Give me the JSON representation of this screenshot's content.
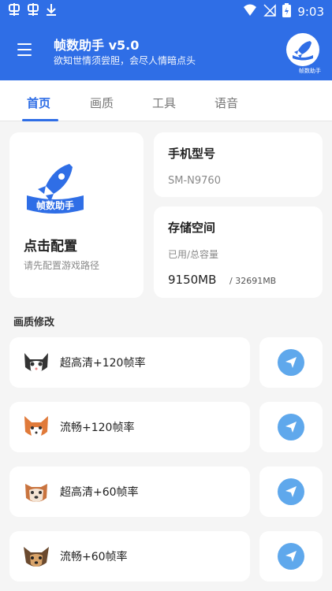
{
  "status_bar": {
    "left_icons": [
      "app-notification-icon",
      "app-notification-icon",
      "download-icon"
    ],
    "right_icons": [
      "wifi-icon",
      "no-signal-icon",
      "battery-icon"
    ],
    "time": "9:03"
  },
  "app_bar": {
    "title": "帧数助手 v5.0",
    "subtitle": "欲知世情须尝胆，会尽人情暗点头",
    "logo_label": "帧数助手"
  },
  "tabs": [
    {
      "label": "首页",
      "active": true
    },
    {
      "label": "画质",
      "active": false
    },
    {
      "label": "工具",
      "active": false
    },
    {
      "label": "语音",
      "active": false
    }
  ],
  "config_card": {
    "logo_text": "帧数助手",
    "title": "点击配置",
    "subtitle": "请先配置游戏路径"
  },
  "model_card": {
    "title": "手机型号",
    "value": "SM-N9760"
  },
  "storage_card": {
    "title": "存储空间",
    "label": "已用/总容量",
    "used": "9150MB",
    "total": "/ 32691MB"
  },
  "section_title": "画质修改",
  "presets": [
    {
      "label": "超高清+120帧率",
      "icon": "cat-icon"
    },
    {
      "label": "流畅+120帧率",
      "icon": "fox-icon"
    },
    {
      "label": "超高清+60帧率",
      "icon": "dog-icon"
    },
    {
      "label": "流畅+60帧率",
      "icon": "puppy-icon"
    }
  ],
  "colors": {
    "primary": "#2f6ee6",
    "send_button": "#5fa8ec",
    "background": "#f5f5f5"
  }
}
